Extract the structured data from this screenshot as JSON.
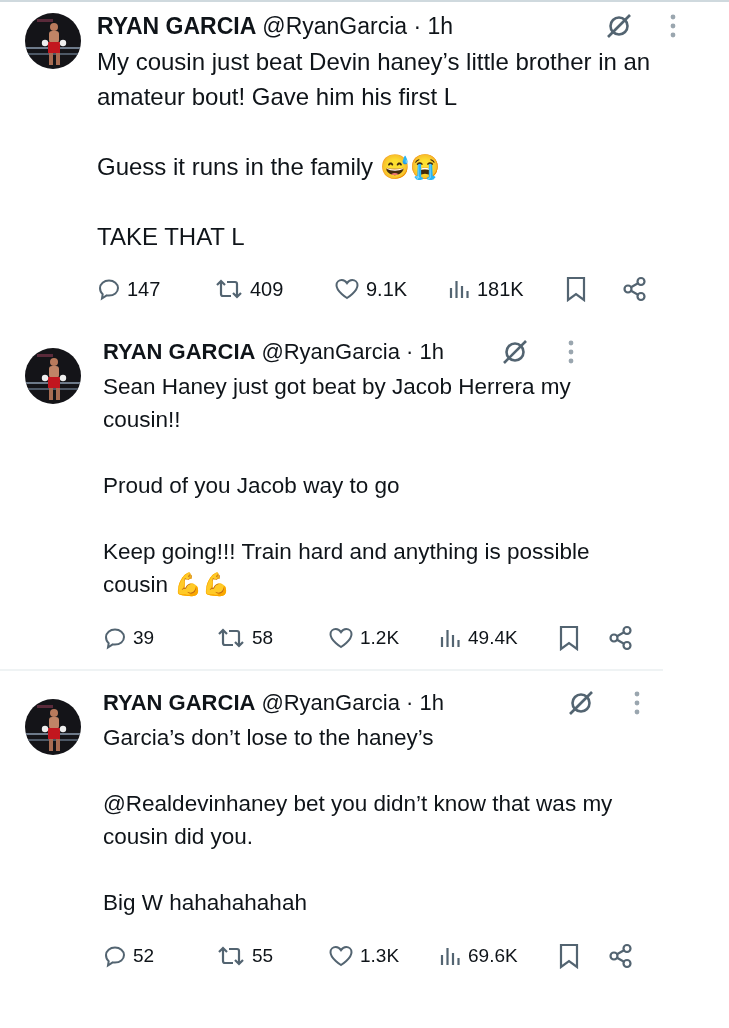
{
  "tweets": [
    {
      "name": "RYAN GARCIA",
      "meta": "@RyanGarcia · 1h",
      "paragraphs": [
        "My cousin just beat Devin haney’s little brother in an amateur bout! Gave him his first L",
        "Guess it runs in the family 😅😭",
        "TAKE THAT L"
      ],
      "stats": {
        "replies": "147",
        "reposts": "409",
        "likes": "9.1K",
        "views": "181K"
      }
    },
    {
      "name": "RYAN GARCIA",
      "meta": "@RyanGarcia · 1h",
      "paragraphs": [
        "Sean Haney just got beat by Jacob Herrera my cousin!!",
        "Proud of you Jacob way to go",
        "Keep going!!! Train hard and anything is possible cousin 💪💪"
      ],
      "stats": {
        "replies": "39",
        "reposts": "58",
        "likes": "1.2K",
        "views": "49.4K"
      }
    },
    {
      "name": "RYAN GARCIA",
      "meta": "@RyanGarcia · 1h",
      "paragraphs": [
        "Garcia’s don’t lose to the haney’s",
        "@Realdevinhaney bet you didn’t know that was my cousin did you.",
        "Big W hahahahahah"
      ],
      "stats": {
        "replies": "52",
        "reposts": "55",
        "likes": "1.3K",
        "views": "69.6K"
      }
    }
  ]
}
